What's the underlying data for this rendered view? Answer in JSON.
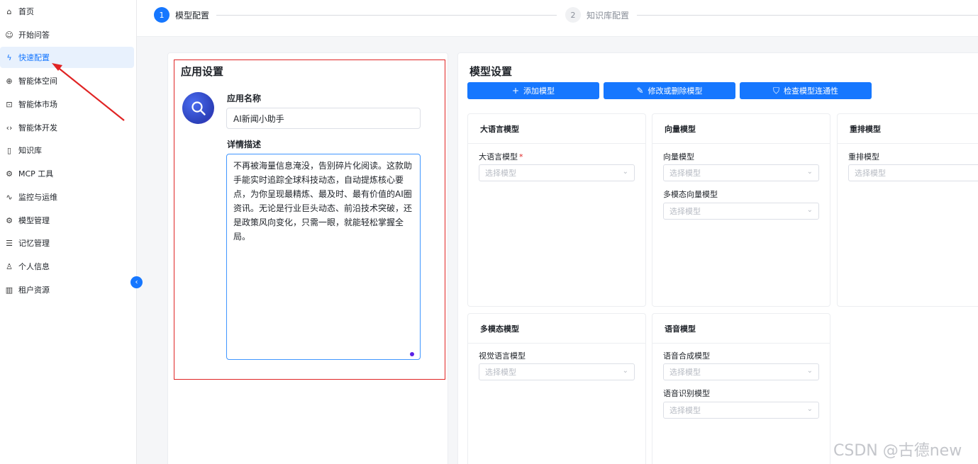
{
  "sidebar": {
    "items": [
      {
        "label": "首页",
        "icon": "home-icon",
        "glyph": "⌂"
      },
      {
        "label": "开始问答",
        "icon": "robot-icon",
        "glyph": "☺"
      },
      {
        "label": "快速配置",
        "icon": "lightning-icon",
        "glyph": "ϟ"
      },
      {
        "label": "智能体空间",
        "icon": "globe-icon",
        "glyph": "⊕"
      },
      {
        "label": "智能体市场",
        "icon": "shopping-bag-icon",
        "glyph": "⊡"
      },
      {
        "label": "智能体开发",
        "icon": "code-icon",
        "glyph": "‹›"
      },
      {
        "label": "知识库",
        "icon": "book-icon",
        "glyph": "▯"
      },
      {
        "label": "MCP 工具",
        "icon": "plug-icon",
        "glyph": "⚙"
      },
      {
        "label": "监控与运维",
        "icon": "pulse-icon",
        "glyph": "∿"
      },
      {
        "label": "模型管理",
        "icon": "settings-icon",
        "glyph": "⚙"
      },
      {
        "label": "记忆管理",
        "icon": "database-icon",
        "glyph": "☰"
      },
      {
        "label": "个人信息",
        "icon": "user-icon",
        "glyph": "♙"
      },
      {
        "label": "租户资源",
        "icon": "building-icon",
        "glyph": "▥"
      }
    ],
    "active_index": 2,
    "collapse_glyph": "‹"
  },
  "steps": [
    {
      "num": "1",
      "label": "模型配置"
    },
    {
      "num": "2",
      "label": "知识库配置"
    }
  ],
  "app_settings": {
    "title": "应用设置",
    "name_label": "应用名称",
    "name_value": "AI新闻小助手",
    "desc_label": "详情描述",
    "desc_value": "不再被海量信息淹没，告别碎片化阅读。这款助手能实时追踪全球科技动态，自动提炼核心要点，为你呈现最精炼、最及时、最有价值的AI圈资讯。无论是行业巨头动态、前沿技术突破，还是政策风向变化，只需一眼，就能轻松掌握全局。"
  },
  "model_settings": {
    "title": "模型设置",
    "buttons": {
      "add": {
        "label": "添加模型",
        "glyph": "+"
      },
      "edit": {
        "label": "修改或删除模型",
        "glyph": "✎"
      },
      "check": {
        "label": "检查模型连通性",
        "glyph": "⛉"
      }
    },
    "placeholder": "选择模型",
    "chevron": "⌄",
    "cards": {
      "llm": {
        "title": "大语言模型",
        "field1": "大语言模型",
        "required_mark": "*"
      },
      "vector": {
        "title": "向量模型",
        "field1": "向量模型",
        "field2": "多模态向量模型"
      },
      "rerank": {
        "title": "重排模型",
        "field1": "重排模型"
      },
      "multimodal": {
        "title": "多模态模型",
        "field1": "视觉语言模型"
      },
      "speech": {
        "title": "语音模型",
        "field1": "语音合成模型",
        "field2": "语音识别模型"
      }
    }
  },
  "watermark": "CSDN @古德new",
  "colors": {
    "accent": "#1677ff",
    "annotation": "#e02424"
  }
}
